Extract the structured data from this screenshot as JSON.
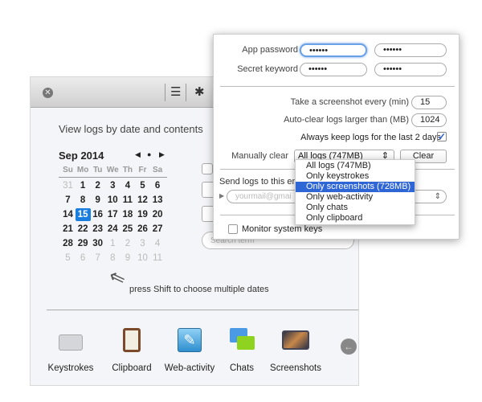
{
  "main_window": {
    "toolbar": {
      "close_icon": "close-circle-icon",
      "list_icon": "list-icon",
      "gear_icon": "gear-icon"
    },
    "heading": "View logs by date and contents",
    "calendar": {
      "month_label": "Sep 2014",
      "weekdays": [
        "Su",
        "Mo",
        "Tu",
        "We",
        "Th",
        "Fr",
        "Sa"
      ],
      "weeks": [
        [
          "31",
          "1",
          "2",
          "3",
          "4",
          "5",
          "6"
        ],
        [
          "7",
          "8",
          "9",
          "10",
          "11",
          "12",
          "13"
        ],
        [
          "14",
          "15",
          "16",
          "17",
          "18",
          "19",
          "20"
        ],
        [
          "21",
          "22",
          "23",
          "24",
          "25",
          "26",
          "27"
        ],
        [
          "28",
          "29",
          "30",
          "1",
          "2",
          "3",
          "4"
        ],
        [
          "5",
          "6",
          "7",
          "8",
          "9",
          "10",
          "11"
        ]
      ],
      "selected_day": "15"
    },
    "hint": "press Shift to choose multiple dates",
    "search_placeholder": "Search term",
    "categories": [
      {
        "label": "Keystrokes",
        "icon": "keyboard-icon"
      },
      {
        "label": "Clipboard",
        "icon": "clipboard-icon"
      },
      {
        "label": "Web-activity",
        "icon": "compass-icon"
      },
      {
        "label": "Chats",
        "icon": "chat-bubbles-icon"
      },
      {
        "label": "Screenshots",
        "icon": "screenshot-icon"
      }
    ]
  },
  "settings": {
    "app_password_label": "App password",
    "app_password_value": "••••••",
    "app_password_confirm": "••••••",
    "secret_keyword_label": "Secret keyword",
    "secret_keyword_value": "••••••",
    "secret_keyword_confirm": "••••••",
    "screenshot_label": "Take a screenshot every (min)",
    "screenshot_value": "15",
    "autoclear_label": "Auto-clear logs larger than (MB)",
    "autoclear_value": "1024",
    "keep_logs_label": "Always keep logs for the last 2 days",
    "keep_logs_checked": true,
    "manual_clear_label": "Manually clear",
    "manual_clear_selected": "All logs (747MB)",
    "clear_button": "Clear",
    "send_logs_label": "Send logs to this em",
    "email_placeholder": "yourmail@gmai",
    "monitor_keys_label": "Monitor system keys",
    "menu_items": [
      "All logs (747MB)",
      "Only keystrokes",
      "Only screenshots (728MB)",
      "Only web-activity",
      "Only chats",
      "Only clipboard"
    ],
    "menu_highlighted": 2
  }
}
